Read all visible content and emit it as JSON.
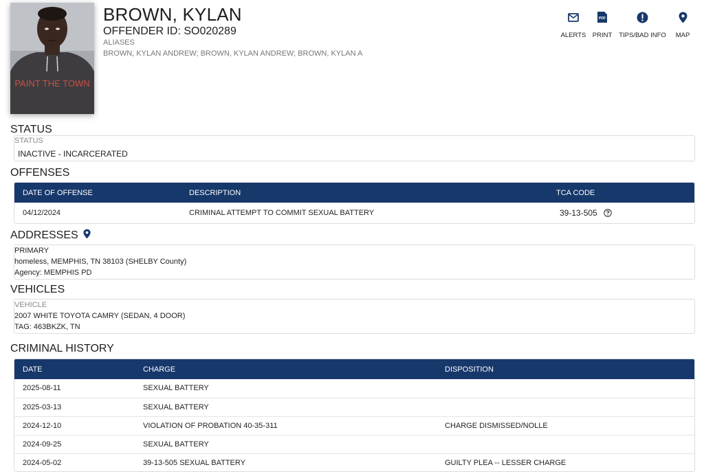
{
  "profile": {
    "name": "BROWN, KYLAN",
    "offender_id": "OFFENDER ID: SO020289",
    "aliases_label": "ALIASES",
    "aliases_value": "BROWN, KYLAN ANDREW; BROWN, KYLAN ANDREW; BROWN, KYLAN A",
    "photo_shirt_text": "PAINT THE TOWN"
  },
  "toolbar": {
    "alerts": "ALERTS",
    "print": "PRINT",
    "tips": "TIPS/BAD INFO",
    "map": "MAP",
    "pdf_badge": "PDF"
  },
  "status": {
    "title": "STATUS",
    "label": "STATUS",
    "value": "INACTIVE - INCARCERATED"
  },
  "offenses": {
    "title": "OFFENSES",
    "headers": [
      "DATE OF OFFENSE",
      "DESCRIPTION",
      "TCA CODE"
    ],
    "rows": [
      {
        "date": "04/12/2024",
        "description": "CRIMINAL ATTEMPT TO COMMIT SEXUAL BATTERY",
        "tca": "39-13-505"
      }
    ]
  },
  "addresses": {
    "title": "ADDRESSES",
    "type": "PRIMARY",
    "line": "homeless, MEMPHIS, TN 38103 (SHELBY County)",
    "agency": "Agency: MEMPHIS PD"
  },
  "vehicles": {
    "title": "VEHICLES",
    "label": "VEHICLE",
    "desc": "2007 WHITE TOYOTA CAMRY (SEDAN, 4 DOOR)",
    "tag": "TAG: 463BKZK, TN"
  },
  "history": {
    "title": "CRIMINAL HISTORY",
    "headers": [
      "DATE",
      "CHARGE",
      "DISPOSITION"
    ],
    "rows": [
      {
        "date": "2025-08-11",
        "charge": "SEXUAL BATTERY",
        "disposition": ""
      },
      {
        "date": "2025-03-13",
        "charge": "SEXUAL BATTERY",
        "disposition": ""
      },
      {
        "date": "2024-12-10",
        "charge": "VIOLATION OF PROBATION 40-35-311",
        "disposition": "CHARGE DISMISSED/NOLLE"
      },
      {
        "date": "2024-09-25",
        "charge": "SEXUAL BATTERY",
        "disposition": ""
      },
      {
        "date": "2024-05-02",
        "charge": "39-13-505 SEXUAL BATTERY",
        "disposition": "GUILTY PLEA -- LESSER CHARGE"
      }
    ]
  },
  "colors": {
    "header_bg": "#17386b",
    "icon": "#17386b"
  }
}
